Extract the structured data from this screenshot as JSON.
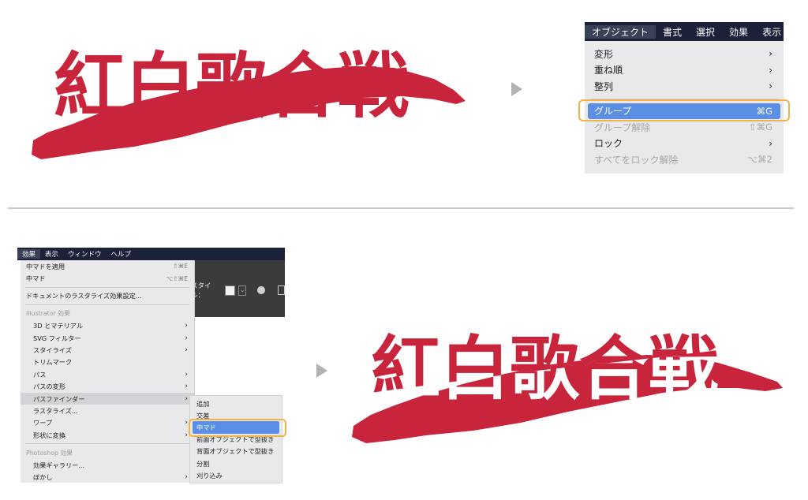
{
  "hero_text": "紅白歌合戦",
  "colors": {
    "brand_red": "#c8243b",
    "highlight": "#f1b444",
    "menu_select": "#5b8fe6",
    "menubar": "#1a2138"
  },
  "top_menu": {
    "menubar": [
      "オブジェクト",
      "書式",
      "選択",
      "効果",
      "表示"
    ],
    "items": [
      {
        "label": "変形",
        "shortcut": "",
        "submenu": true,
        "disabled": false
      },
      {
        "label": "重ね順",
        "shortcut": "",
        "submenu": true,
        "disabled": false
      },
      {
        "label": "整列",
        "shortcut": "",
        "submenu": true,
        "disabled": false
      },
      {
        "label": "グループ",
        "shortcut": "⌘G",
        "submenu": false,
        "disabled": false,
        "selected": true
      },
      {
        "label": "グループ解除",
        "shortcut": "⇧⌘G",
        "submenu": false,
        "disabled": true
      },
      {
        "label": "ロック",
        "shortcut": "",
        "submenu": true,
        "disabled": false
      },
      {
        "label": "すべてをロック解除",
        "shortcut": "⌥⌘2",
        "submenu": false,
        "disabled": true
      }
    ]
  },
  "effects_app": {
    "menubar": [
      "効果",
      "表示",
      "ウィンドウ",
      "ヘルプ"
    ],
    "toolbar": {
      "style_label": "スタイル："
    },
    "items_top": [
      {
        "label": "中マドを適用",
        "shortcut": "⇧⌘E"
      },
      {
        "label": "中マド",
        "shortcut": "⌥⇧⌘E"
      }
    ],
    "raster_settings": "ドキュメントのラスタライズ効果設定...",
    "illustrator_header": "Illustrator 効果",
    "illustrator_items": [
      {
        "label": "3D とマテリアル",
        "submenu": true
      },
      {
        "label": "SVG フィルター",
        "submenu": true
      },
      {
        "label": "スタイライズ",
        "submenu": true
      },
      {
        "label": "トリムマーク",
        "submenu": false
      },
      {
        "label": "パス",
        "submenu": true
      },
      {
        "label": "パスの変形",
        "submenu": true
      },
      {
        "label": "パスファインダー",
        "submenu": true,
        "active": true
      },
      {
        "label": "ラスタライズ...",
        "submenu": false
      },
      {
        "label": "ワープ",
        "submenu": true
      },
      {
        "label": "形状に変換",
        "submenu": true
      }
    ],
    "photoshop_header": "Photoshop 効果",
    "photoshop_items": [
      {
        "label": "効果ギャラリー...",
        "submenu": false
      },
      {
        "label": "ぼかし",
        "submenu": true
      }
    ],
    "pathfinder_submenu": [
      "追加",
      "交差",
      "中マド",
      "前面オブジェクトで型抜き",
      "背面オブジェクトで型抜き",
      "分割",
      "刈り込み"
    ],
    "pathfinder_selected": "中マド"
  }
}
